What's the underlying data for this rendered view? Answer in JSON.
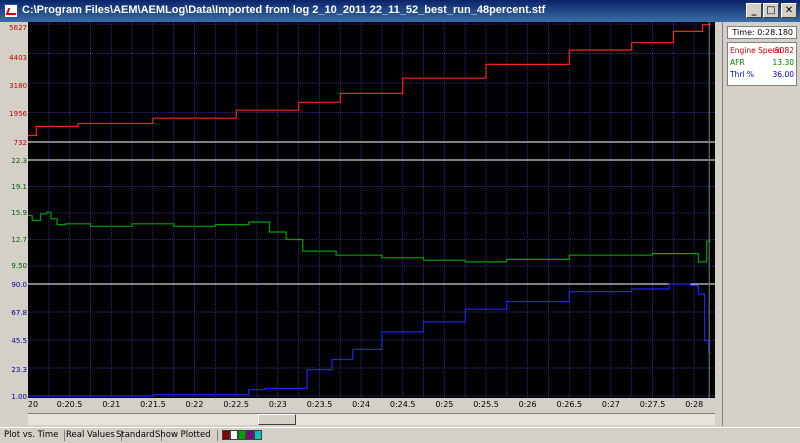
{
  "window": {
    "title": "C:\\Program Files\\AEM\\AEMLog\\Data\\Imported from log 2_10_2011 22_11_52_best_run_48percent.stf",
    "minimize": "_",
    "maximize": "□",
    "close": "✕"
  },
  "colors": {
    "engine_speed": "#ff2020",
    "afr": "#00a000",
    "throttle": "#2020ff",
    "grid": "#2a2a8a",
    "separator": "#ffffff"
  },
  "axes": {
    "engine_speed": [
      "5627",
      "4403",
      "3180",
      "1956",
      "732"
    ],
    "afr": [
      "22.3",
      "19.1",
      "15.9",
      "12.7",
      "9.50"
    ],
    "throttle": [
      "90.0",
      "67.8",
      "45.5",
      "23.3",
      "1.00"
    ]
  },
  "x_ticks": [
    "20",
    "0:20.5",
    "0:21",
    "0:21.5",
    "0:22",
    "0:22.5",
    "0:23",
    "0:23.5",
    "0:24",
    "0:24.5",
    "0:25",
    "0:25.5",
    "0:26",
    "0:26.5",
    "0:27",
    "0:27.5",
    "0:28"
  ],
  "panel": {
    "time": "Time: 0:28.180",
    "legend": [
      {
        "name": "Engine Speed",
        "value": "5082",
        "color": "#c00000"
      },
      {
        "name": "AFR",
        "value": "13.30",
        "color": "#008000"
      },
      {
        "name": "Thrl %",
        "value": "36.00",
        "color": "#0000c0"
      }
    ]
  },
  "statusbar": {
    "plot_mode": "Plot vs. Time",
    "values_mode": "Real Values",
    "view_mode": "Standard",
    "show_mode": "Show Plotted"
  },
  "chart_data": [
    {
      "type": "line",
      "ylabel": "",
      "ylim": [
        732,
        5627
      ],
      "series": [
        {
          "name": "Engine Speed",
          "x": [
            20.0,
            20.2,
            21.0,
            22.0,
            23.0,
            23.5,
            24.0,
            25.0,
            26.0,
            27.0,
            27.5,
            28.0,
            28.2
          ],
          "values": [
            1000,
            1380,
            1500,
            1720,
            2050,
            2380,
            2750,
            3380,
            3950,
            4550,
            4850,
            5320,
            5600
          ]
        }
      ]
    },
    {
      "type": "line",
      "ylabel": "",
      "ylim": [
        9.5,
        22.3
      ],
      "series": [
        {
          "name": "AFR",
          "x": [
            20.0,
            20.1,
            20.2,
            20.25,
            20.3,
            20.4,
            20.5,
            21.0,
            21.5,
            22.0,
            22.5,
            22.8,
            23.0,
            23.2,
            23.4,
            24.0,
            24.5,
            25.0,
            25.5,
            26.0,
            27.0,
            28.0,
            28.1,
            28.2
          ],
          "values": [
            15.6,
            15.0,
            15.8,
            16.0,
            15.2,
            14.5,
            14.6,
            14.3,
            14.6,
            14.3,
            14.5,
            14.8,
            13.6,
            12.7,
            11.3,
            10.8,
            10.5,
            10.2,
            10.0,
            10.3,
            10.8,
            11.0,
            10.0,
            12.5
          ]
        }
      ]
    },
    {
      "type": "line",
      "ylabel": "",
      "ylim": [
        1.0,
        90.0
      ],
      "series": [
        {
          "name": "Thrl %",
          "x": [
            20.0,
            21.0,
            22.0,
            22.6,
            22.7,
            23.0,
            23.2,
            23.5,
            23.8,
            24.0,
            24.5,
            25.0,
            25.5,
            26.0,
            27.0,
            27.5,
            27.9,
            28.0,
            28.1,
            28.15,
            28.2
          ],
          "values": [
            1.0,
            1.0,
            2.0,
            2.0,
            6.0,
            7.0,
            7.0,
            22.0,
            30.0,
            38.0,
            52.0,
            60.0,
            70.0,
            76.0,
            84.0,
            86.0,
            90.0,
            89.0,
            82.0,
            45.0,
            36.0
          ]
        }
      ]
    }
  ]
}
